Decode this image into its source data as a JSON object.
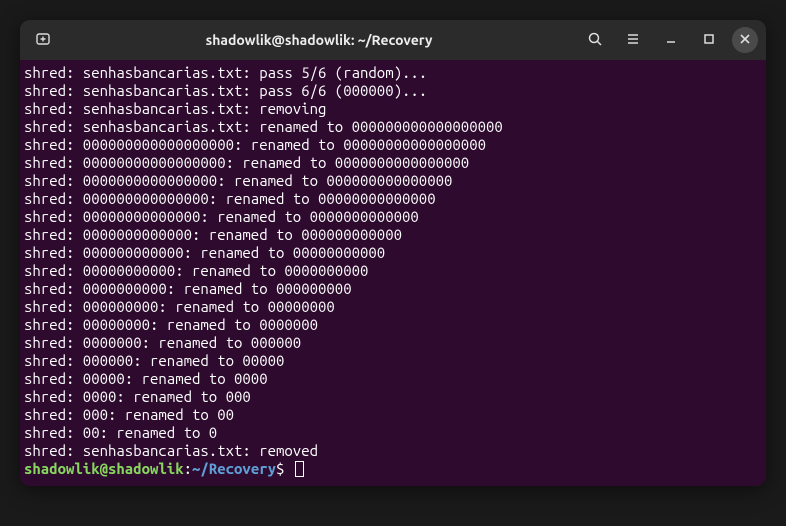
{
  "window": {
    "title": "shadowlik@shadowlik: ~/Recovery"
  },
  "output": {
    "lines": [
      "shred: senhasbancarias.txt: pass 5/6 (random)...",
      "shred: senhasbancarias.txt: pass 6/6 (000000)...",
      "shred: senhasbancarias.txt: removing",
      "shred: senhasbancarias.txt: renamed to 000000000000000000",
      "shred: 000000000000000000: renamed to 00000000000000000",
      "shred: 00000000000000000: renamed to 0000000000000000",
      "shred: 0000000000000000: renamed to 000000000000000",
      "shred: 000000000000000: renamed to 00000000000000",
      "shred: 00000000000000: renamed to 0000000000000",
      "shred: 0000000000000: renamed to 000000000000",
      "shred: 000000000000: renamed to 00000000000",
      "shred: 00000000000: renamed to 0000000000",
      "shred: 0000000000: renamed to 000000000",
      "shred: 000000000: renamed to 00000000",
      "shred: 00000000: renamed to 0000000",
      "shred: 0000000: renamed to 000000",
      "shred: 000000: renamed to 00000",
      "shred: 00000: renamed to 0000",
      "shred: 0000: renamed to 000",
      "shred: 000: renamed to 00",
      "shred: 00: renamed to 0",
      "shred: senhasbancarias.txt: removed"
    ]
  },
  "prompt": {
    "user_host": "shadowlik@shadowlik",
    "colon": ":",
    "path": "~/Recovery",
    "dollar": "$"
  }
}
